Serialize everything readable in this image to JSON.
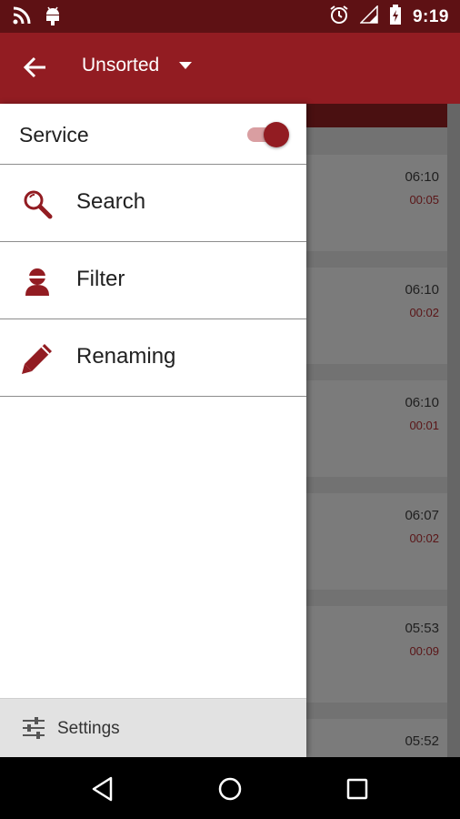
{
  "status_bar": {
    "time": "9:19",
    "icons": [
      "rss-icon",
      "android-icon",
      "alarm-icon",
      "signal-icon",
      "battery-icon"
    ]
  },
  "app_bar": {
    "title": "Unsorted",
    "back_icon": "arrow-left-icon",
    "dropdown_icon": "caret-down-icon",
    "color": "#921c22"
  },
  "drawer": {
    "service": {
      "label": "Service",
      "enabled": true
    },
    "items": [
      {
        "label": "Search",
        "icon": "search-icon"
      },
      {
        "label": "Filter",
        "icon": "filter-user-icon"
      },
      {
        "label": "Renaming",
        "icon": "pencil-icon"
      }
    ],
    "settings": {
      "label": "Settings",
      "icon": "sliders-icon"
    }
  },
  "background_list": [
    {
      "time": "06:10",
      "duration": "00:05"
    },
    {
      "time": "06:10",
      "duration": "00:02"
    },
    {
      "time": "06:10",
      "duration": "00:01"
    },
    {
      "time": "06:07",
      "duration": "00:02"
    },
    {
      "time": "05:53",
      "duration": "00:09"
    },
    {
      "time": "05:52",
      "duration": ""
    }
  ],
  "nav_bar": {
    "icons": [
      "back-triangle-icon",
      "home-circle-icon",
      "recents-square-icon"
    ]
  },
  "colors": {
    "accent": "#921c22",
    "status_bar": "#5e1114"
  }
}
